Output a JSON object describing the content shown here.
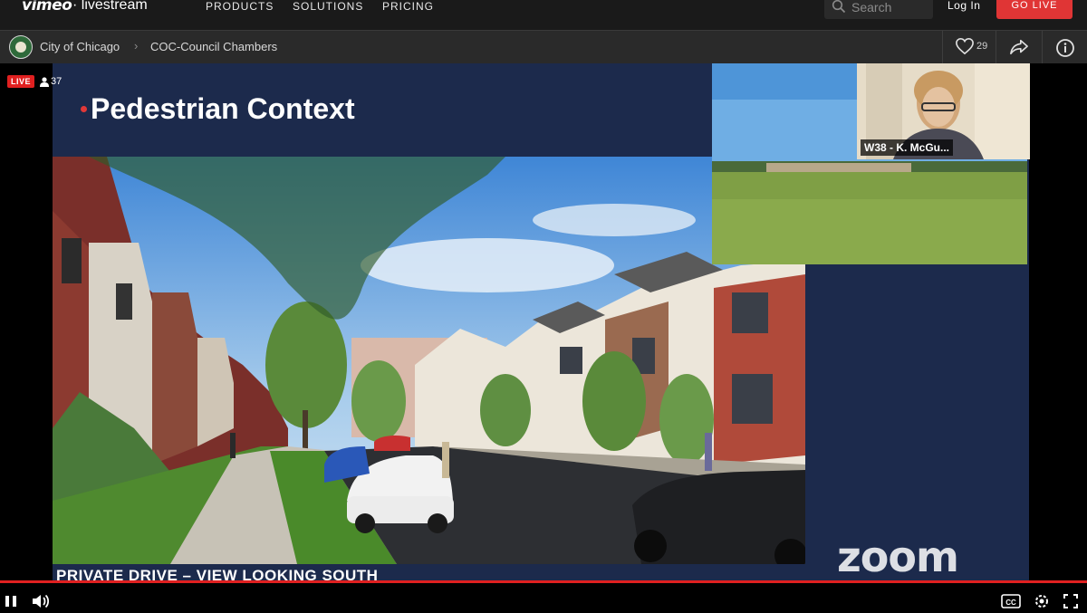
{
  "nav": {
    "logo": "vimeo",
    "logo_sub": "· livestream",
    "items": [
      "PRODUCTS",
      "SOLUTIONS",
      "PRICING"
    ],
    "search_placeholder": "Search",
    "login": "Log In",
    "golive": "GO LIVE"
  },
  "channel": {
    "crumbs": [
      "City of Chicago",
      "COC-Council Chambers"
    ],
    "likes": "29"
  },
  "stream": {
    "live_badge": "LIVE",
    "viewers": "37",
    "progress_fraction": 1.0
  },
  "slide": {
    "title": "Pedestrian Context",
    "caption": "PRIVATE DRIVE – VIEW LOOKING SOUTH",
    "zoom_logo": "zoom"
  },
  "participant": {
    "name": "W38 - K. McGu..."
  },
  "icons": [
    "search-icon",
    "heart-icon",
    "share-icon",
    "info-icon",
    "person-icon",
    "pause-icon",
    "volume-icon",
    "cc-icon",
    "settings-icon",
    "fullscreen-icon"
  ],
  "colors": {
    "accent": "#e03535",
    "slide_bg": "#1c2a4c",
    "nav_bg": "#1a1a1a"
  }
}
